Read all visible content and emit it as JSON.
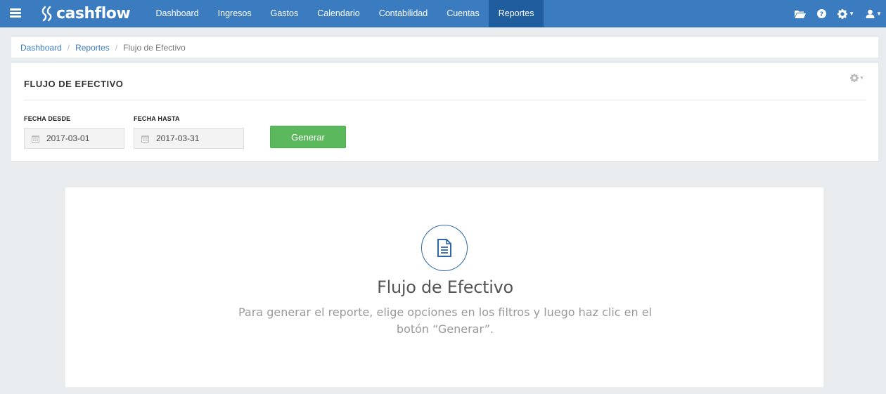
{
  "navbar": {
    "logo_text": "cashflow",
    "items": [
      {
        "label": "Dashboard",
        "active": false
      },
      {
        "label": "Ingresos",
        "active": false
      },
      {
        "label": "Gastos",
        "active": false
      },
      {
        "label": "Calendario",
        "active": false
      },
      {
        "label": "Contabilidad",
        "active": false
      },
      {
        "label": "Cuentas",
        "active": false
      },
      {
        "label": "Reportes",
        "active": true
      }
    ],
    "right_icons": [
      "folder-open-icon",
      "help-icon",
      "gear-icon",
      "user-icon"
    ],
    "accent_color": "#3a7cbf",
    "active_color": "#1f5d9e"
  },
  "breadcrumb": {
    "items": [
      "Dashboard",
      "Reportes"
    ],
    "current": "Flujo de Efectivo"
  },
  "filters": {
    "title": "FLUJO DE EFECTIVO",
    "fecha_desde_label": "FECHA DESDE",
    "fecha_desde_value": "2017-03-01",
    "fecha_hasta_label": "FECHA HASTA",
    "fecha_hasta_value": "2017-03-31",
    "generate_label": "Generar",
    "generate_color": "#5cb85c"
  },
  "empty_state": {
    "icon": "document-icon",
    "title": "Flujo de Efectivo",
    "message": "Para generar el reporte, elige opciones en los filtros y luego haz clic en el botón “Generar”."
  }
}
